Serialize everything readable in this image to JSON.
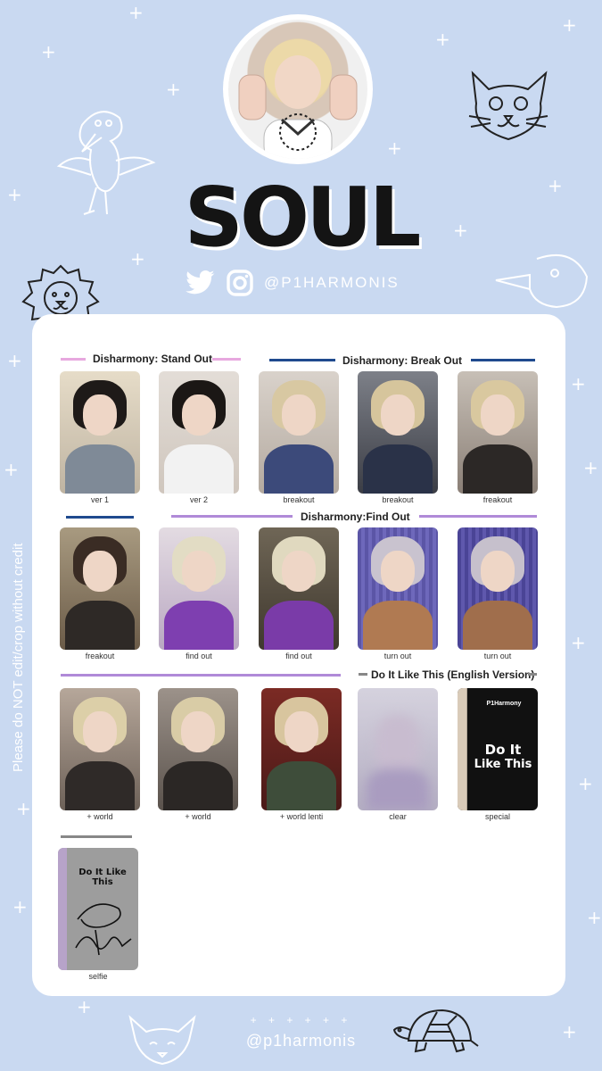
{
  "header": {
    "title": "SOUL",
    "handle": "@P1HARMONIS"
  },
  "watermark": "Please do NOT edit/crop without credit",
  "footer": {
    "plus_row": "+ + + + + +",
    "handle": "@p1harmonis"
  },
  "sections": {
    "stand_out": "Disharmony: Stand Out",
    "break_out": "Disharmony: Break Out",
    "find_out": "Disharmony:Find Out",
    "do_it": "Do It Like This  (English Version)"
  },
  "cards": [
    {
      "caption": "ver 1"
    },
    {
      "caption": "ver 2"
    },
    {
      "caption": "breakout"
    },
    {
      "caption": "breakout"
    },
    {
      "caption": "freakout"
    },
    {
      "caption": "freakout"
    },
    {
      "caption": "find out"
    },
    {
      "caption": "find out"
    },
    {
      "caption": "turn out"
    },
    {
      "caption": "turn out"
    },
    {
      "caption": "+ world"
    },
    {
      "caption": "+ world"
    },
    {
      "caption": "+ world lenti"
    },
    {
      "caption": "clear"
    },
    {
      "caption": "special"
    },
    {
      "caption": "selfie"
    }
  ],
  "special_card": {
    "brand": "P1Harmony",
    "line1": "Do It",
    "line2": "Like This"
  },
  "selfie_card": {
    "text": "Do It Like This"
  },
  "colors": {
    "background": "#c9d9f1",
    "pink": "#e7a8df",
    "navy": "#1f4a8e",
    "purple": "#b08ad8",
    "gray": "#888888"
  },
  "icons": [
    "twitter-icon",
    "instagram-icon"
  ]
}
